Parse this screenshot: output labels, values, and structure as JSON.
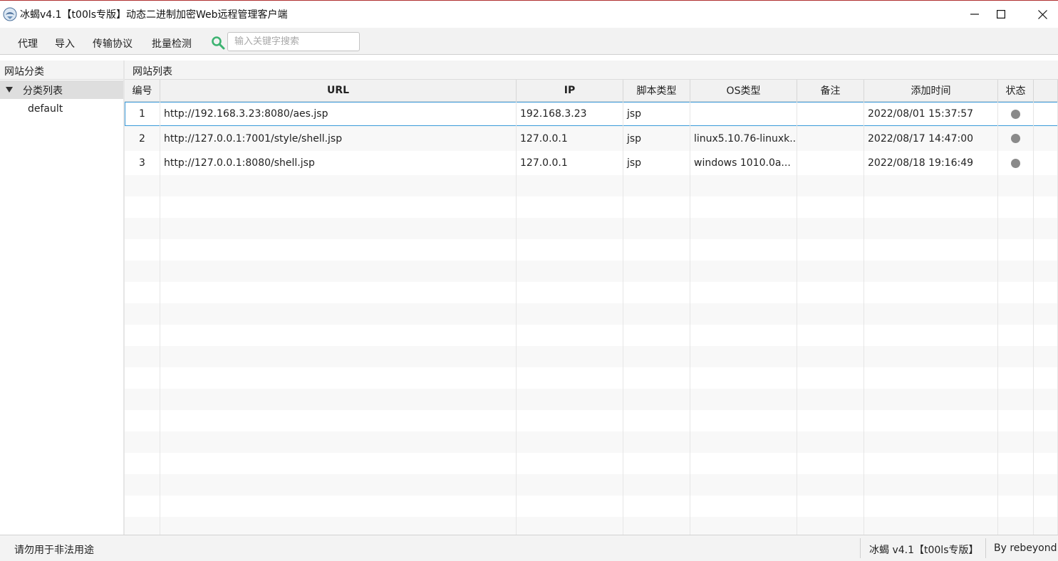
{
  "window": {
    "title": "冰蝎v4.1【t00ls专版】动态二进制加密Web远程管理客户端"
  },
  "menu": {
    "items": [
      "代理",
      "导入",
      "传输协议",
      "批量检测"
    ],
    "search_placeholder": "输入关键字搜索",
    "search_value": ""
  },
  "left_pane": {
    "header": "网站分类",
    "tree_root": "分类列表",
    "tree_children": [
      "default"
    ]
  },
  "right_pane": {
    "header": "网站列表",
    "columns": [
      "编号",
      "URL",
      "IP",
      "脚本类型",
      "OS类型",
      "备注",
      "添加时间",
      "状态",
      ""
    ],
    "rows": [
      {
        "id": "1",
        "url": "http://192.168.3.23:8080/aes.jsp",
        "ip": "192.168.3.23",
        "script": "jsp",
        "os": "",
        "note": "",
        "time": "2022/08/01 15:37:57",
        "status": "grey"
      },
      {
        "id": "2",
        "url": "http://127.0.0.1:7001/style/shell.jsp",
        "ip": "127.0.0.1",
        "script": "jsp",
        "os": "linux5.10.76-linuxk...",
        "note": "",
        "time": "2022/08/17 14:47:00",
        "status": "grey"
      },
      {
        "id": "3",
        "url": "http://127.0.0.1:8080/shell.jsp",
        "ip": "127.0.0.1",
        "script": "jsp",
        "os": "windows 1010.0a...",
        "note": "",
        "time": "2022/08/18 19:16:49",
        "status": "grey"
      }
    ]
  },
  "status_bar": {
    "left": "请勿用于非法用途",
    "version": "冰蝎 v4.1【t00ls专版】",
    "author": "By rebeyond"
  },
  "colors": {
    "selection_border": "#3a9ad9",
    "search_icon": "#3cb371",
    "status_dot": "#8a8a8a"
  }
}
